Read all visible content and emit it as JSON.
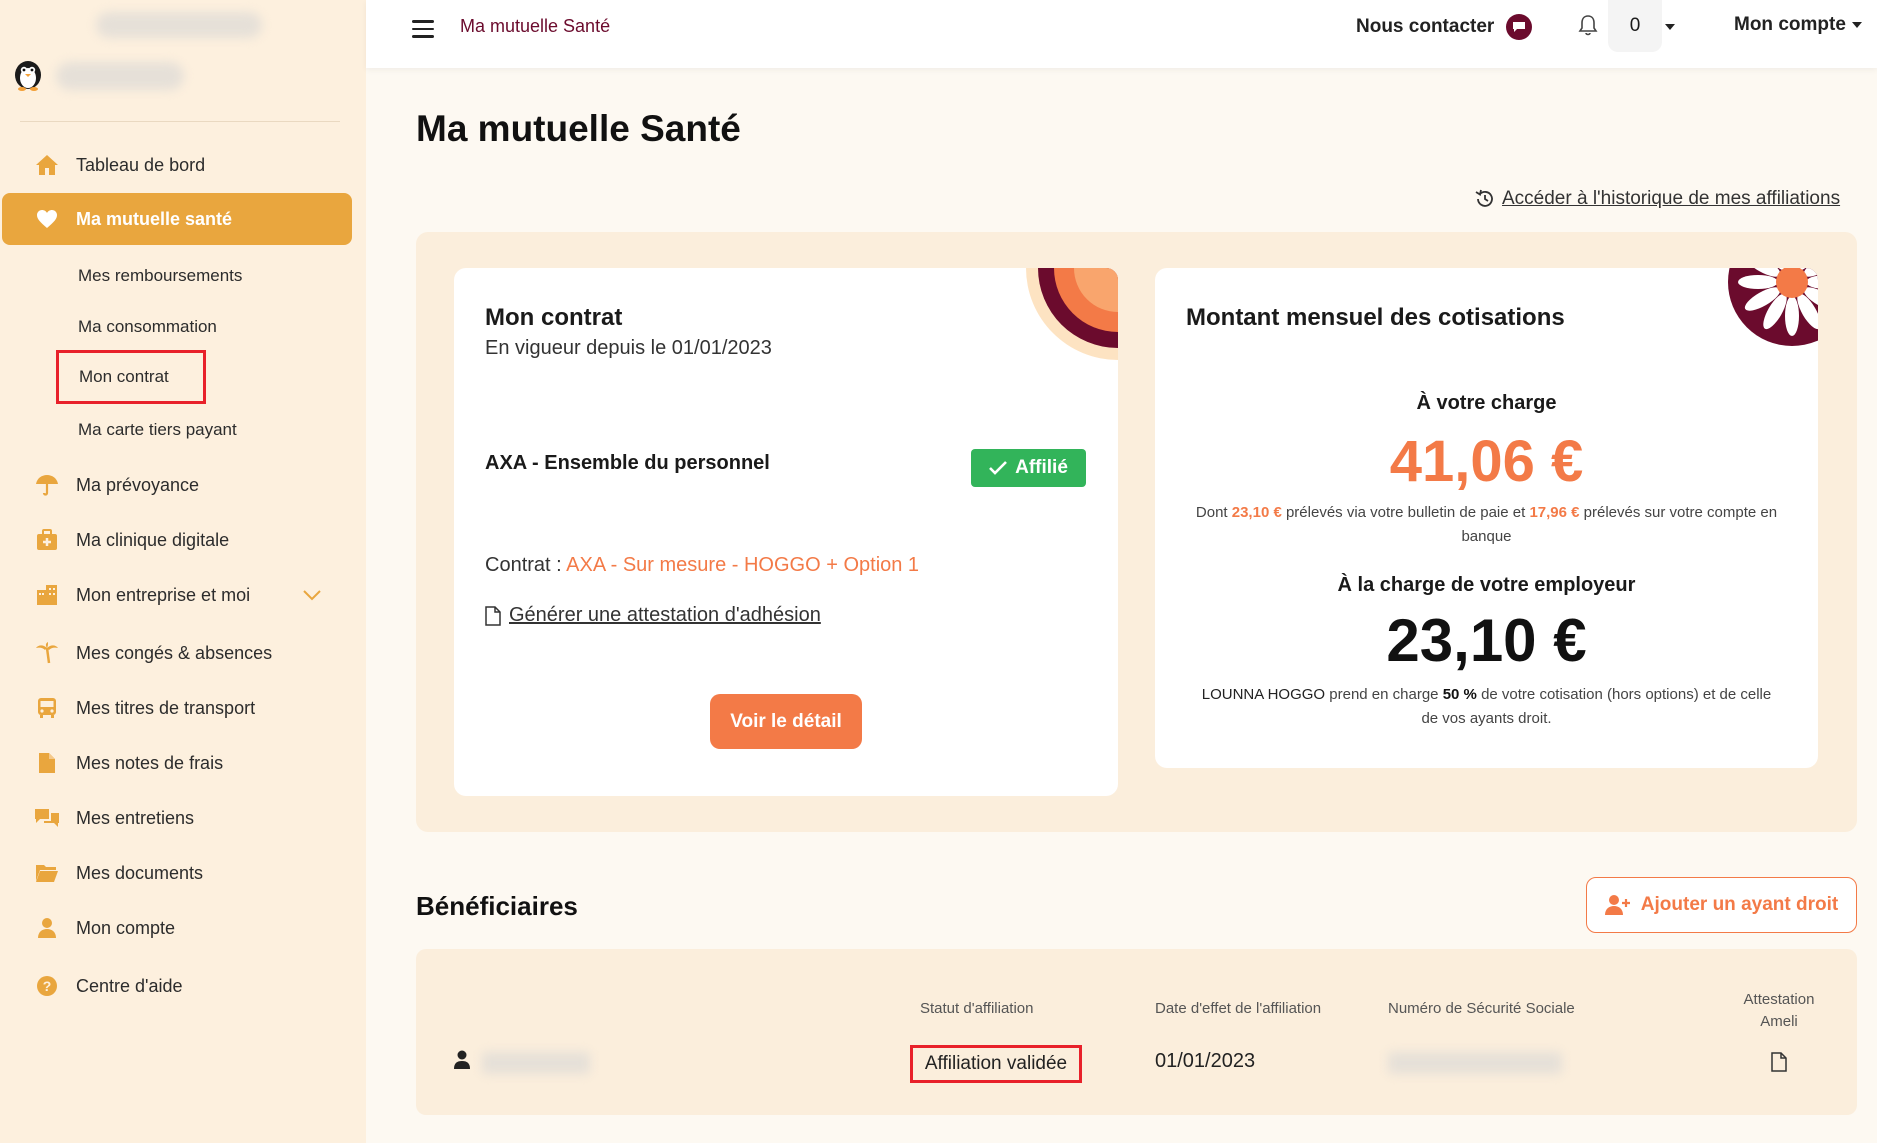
{
  "topbar": {
    "title": "Ma mutuelle Santé",
    "contact_label": "Nous contacter",
    "notif_count": "0",
    "account_label": "Mon compte"
  },
  "sidebar": {
    "items": [
      {
        "label": "Tableau de bord",
        "icon": "home-icon"
      },
      {
        "label": "Ma mutuelle santé",
        "icon": "heart-icon"
      },
      {
        "label": "Ma prévoyance",
        "icon": "umbrella-icon"
      },
      {
        "label": "Ma clinique digitale",
        "icon": "medical-kit-icon"
      },
      {
        "label": "Mon entreprise et moi",
        "icon": "building-icon"
      },
      {
        "label": "Mes congés & absences",
        "icon": "palm-tree-icon"
      },
      {
        "label": "Mes titres de transport",
        "icon": "bus-icon"
      },
      {
        "label": "Mes notes de frais",
        "icon": "file-icon"
      },
      {
        "label": "Mes entretiens",
        "icon": "chat-icon"
      },
      {
        "label": "Mes documents",
        "icon": "folder-icon"
      },
      {
        "label": "Mon compte",
        "icon": "user-icon"
      },
      {
        "label": "Centre d'aide",
        "icon": "help-icon"
      }
    ],
    "sub_items": [
      "Mes remboursements",
      "Ma consommation",
      "Mon contrat",
      "Ma carte tiers payant"
    ]
  },
  "main": {
    "title": "Ma mutuelle Santé",
    "history_link": "Accéder à l'historique de mes affiliations",
    "contract": {
      "heading": "Mon contrat",
      "since": "En vigueur depuis le 01/01/2023",
      "affiliation_name": "AXA - Ensemble du personnel",
      "badge": "Affilié",
      "contract_label": "Contrat : ",
      "contract_value": "AXA - Sur mesure - HOGGO + Option 1",
      "attestation_link": "Générer une attestation d'adhésion",
      "detail_button": "Voir le détail"
    },
    "cotisations": {
      "heading": "Montant mensuel des cotisations",
      "your_charge_label": "À votre charge",
      "your_charge_amount": "41,06 €",
      "note1_a": "Dont ",
      "note1_b": "23,10 €",
      "note1_c": " prélevés via votre bulletin de paie et ",
      "note1_d": "17,96 €",
      "note1_e": " prélevés sur votre compte en banque",
      "employer_label": "À la charge de votre employeur",
      "employer_amount": "23,10 €",
      "note2_a": "LOUNNA HOGGO",
      "note2_b": " prend en charge ",
      "note2_c": "50 %",
      "note2_d": " de votre cotisation (hors options) et de celle de vos ayants droit."
    },
    "beneficiaires": {
      "title": "Bénéficiaires",
      "add_button": "Ajouter un ayant droit",
      "columns": [
        "Statut d'affiliation",
        "Date d'effet de l'affiliation",
        "Numéro de Sécurité Sociale",
        "Attestation Ameli"
      ],
      "row": {
        "status": "Affiliation validée",
        "date": "01/01/2023"
      }
    }
  },
  "colors": {
    "accent": "#e9a63e",
    "orange": "#f37a47",
    "burgundy": "#6b0b2d",
    "success": "#32b45a"
  }
}
